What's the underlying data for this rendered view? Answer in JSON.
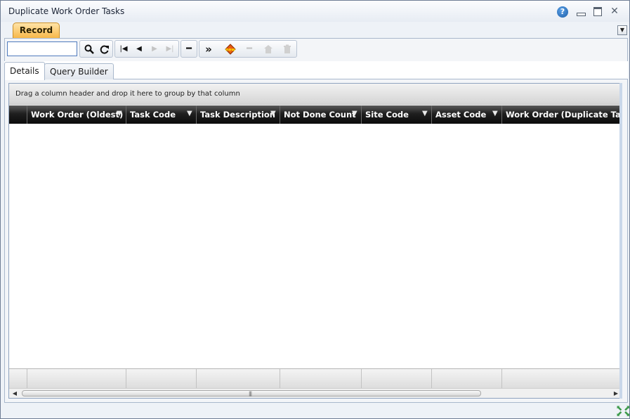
{
  "window": {
    "title": "Duplicate Work Order Tasks",
    "controls": {
      "help": "?",
      "close": "✕"
    }
  },
  "tabs": {
    "record": "Record"
  },
  "toolbar": {
    "search_value": "",
    "icons": [
      "search-icon",
      "refresh-icon",
      "first-record-icon",
      "previous-record-icon",
      "next-record-icon",
      "last-record-icon",
      "minus-icon",
      "forward-icon",
      "new-record-icon",
      "remove-icon",
      "home-icon",
      "delete-icon"
    ]
  },
  "detail_tabs": [
    {
      "label": "Details"
    },
    {
      "label": "Query Builder"
    }
  ],
  "grid": {
    "group_panel_text": "Drag a column header and drop it here to group by that column",
    "columns": [
      {
        "label": "Work Order (Oldest)"
      },
      {
        "label": "Task Code"
      },
      {
        "label": "Task Description"
      },
      {
        "label": "Not Done Count"
      },
      {
        "label": "Site Code"
      },
      {
        "label": "Asset Code"
      },
      {
        "label": "Work Order (Duplicate Task)"
      }
    ],
    "rows": []
  },
  "colors": {
    "accent": "#f7b84a",
    "header_bg": "#1f1f1f",
    "frame": "#a9b8cc"
  }
}
